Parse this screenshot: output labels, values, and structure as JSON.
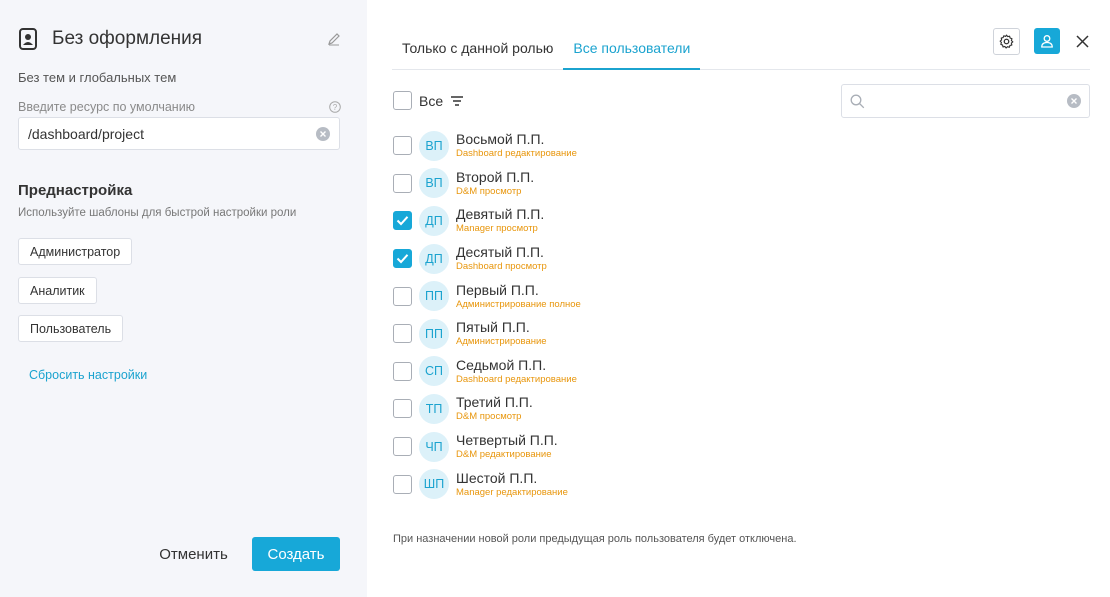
{
  "left_panel": {
    "role_name": "Без оформления",
    "theme_text": "Без тем и глобальных тем",
    "resource_label": "Введите ресурс по умолчанию",
    "resource_value": "/dashboard/project",
    "preset_title": "Преднастройка",
    "preset_subtitle": "Используйте шаблоны для быстрой настройки роли",
    "presets": [
      "Администратор",
      "Аналитик",
      "Пользователь"
    ],
    "reset_label": "Сбросить настройки",
    "cancel_label": "Отменить",
    "create_label": "Создать"
  },
  "right_panel": {
    "tabs": [
      {
        "label": "Только с данной ролью",
        "active": false
      },
      {
        "label": "Все пользователи",
        "active": true
      }
    ],
    "select_all_label": "Все",
    "search_placeholder": "",
    "users": [
      {
        "initials": "ВП",
        "name": "Восьмой П.П.",
        "role": "Dashboard редактирование",
        "checked": false
      },
      {
        "initials": "ВП",
        "name": "Второй П.П.",
        "role": "D&M просмотр",
        "checked": false
      },
      {
        "initials": "ДП",
        "name": "Девятый П.П.",
        "role": "Manager просмотр",
        "checked": true
      },
      {
        "initials": "ДП",
        "name": "Десятый П.П.",
        "role": "Dashboard просмотр",
        "checked": true
      },
      {
        "initials": "ПП",
        "name": "Первый П.П.",
        "role": "Администрирование полное",
        "checked": false
      },
      {
        "initials": "ПП",
        "name": "Пятый П.П.",
        "role": "Администрирование",
        "checked": false
      },
      {
        "initials": "СП",
        "name": "Седьмой П.П.",
        "role": "Dashboard редактирование",
        "checked": false
      },
      {
        "initials": "ТП",
        "name": "Третий П.П.",
        "role": "D&M просмотр",
        "checked": false
      },
      {
        "initials": "ЧП",
        "name": "Четвертый П.П.",
        "role": "D&M редактирование",
        "checked": false
      },
      {
        "initials": "ШП",
        "name": "Шестой П.П.",
        "role": "Manager редактирование",
        "checked": false
      }
    ],
    "footer_note": "При назначении новой роли предыдущая роль пользователя будет отключена."
  },
  "icons": {
    "role": "badge-icon",
    "edit": "pencil-icon",
    "help": "question-icon",
    "clear": "clear-icon",
    "gear": "gear-icon",
    "user": "user-icon",
    "close": "close-icon",
    "filter": "filter-icon",
    "search": "search-icon",
    "check": "check-icon"
  },
  "colors": {
    "accent": "#17a8d8",
    "role_text": "#e8960c",
    "left_bg": "#f5f6fa",
    "avatar_bg": "#dcf1f9"
  }
}
